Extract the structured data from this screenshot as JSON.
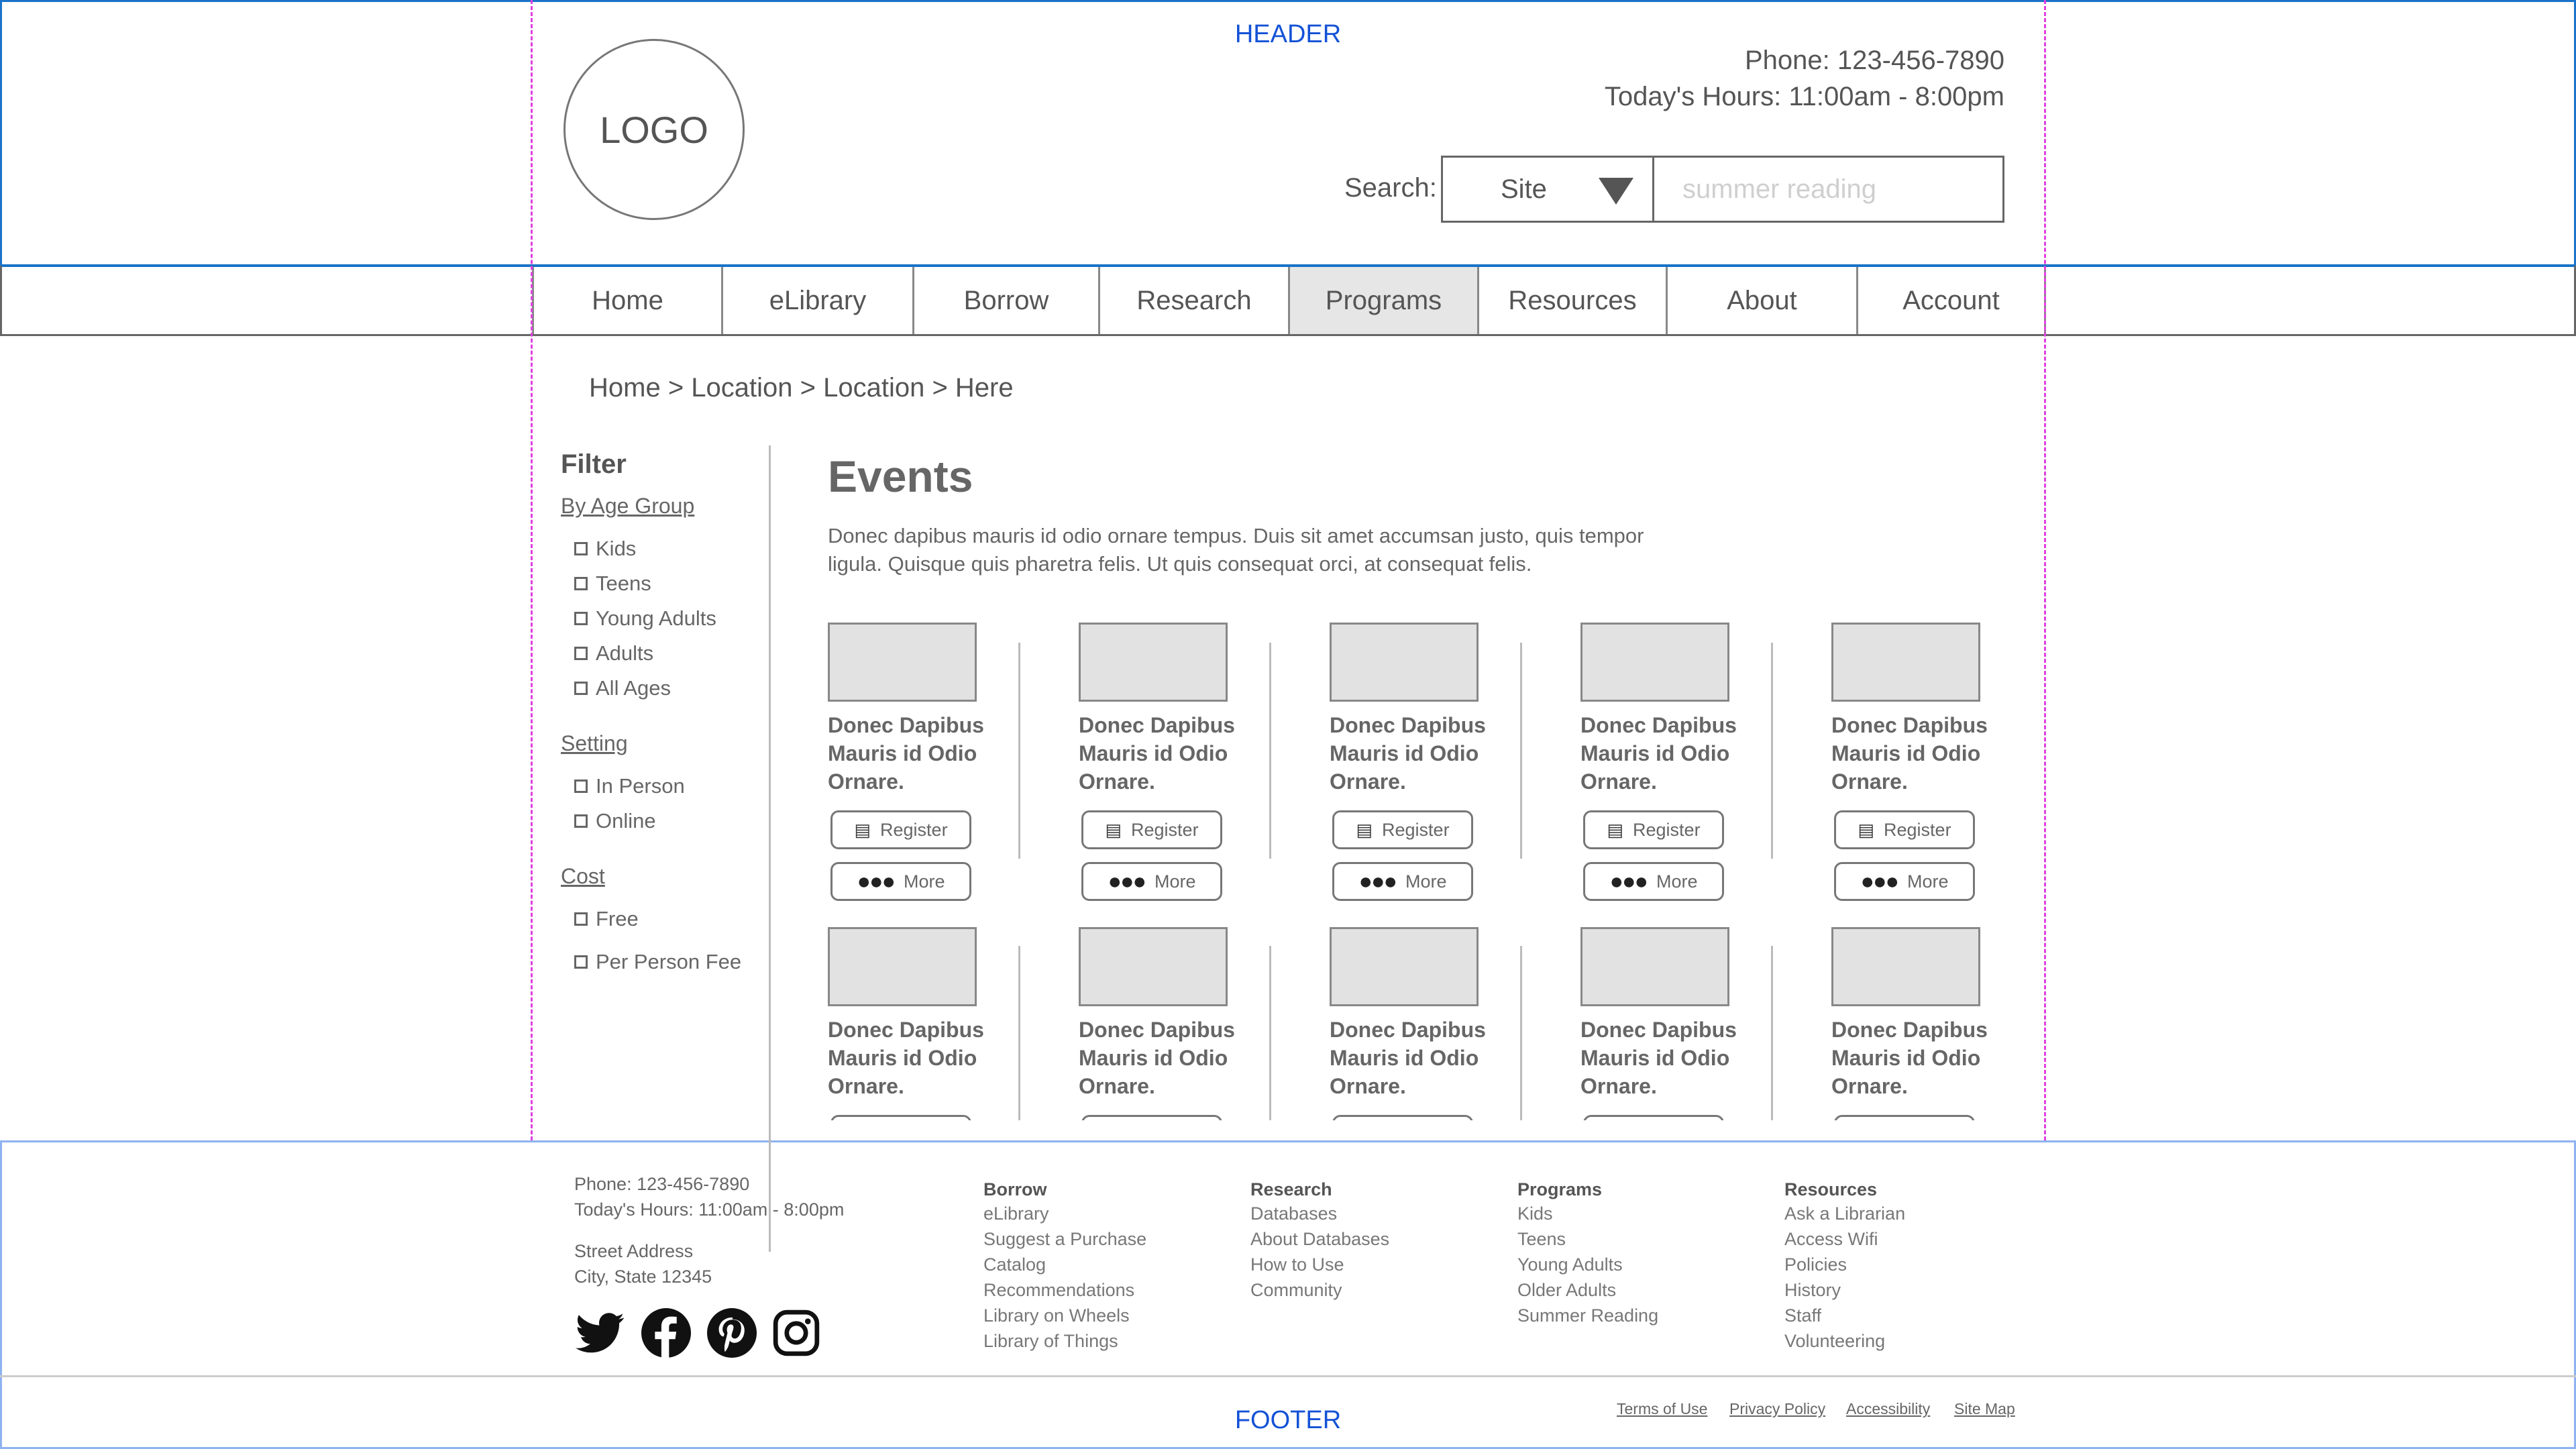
{
  "header": {
    "label": "HEADER",
    "logo": "LOGO",
    "phone": "Phone: 123-456-7890",
    "hours": "Today's Hours:  11:00am - 8:00pm",
    "search_label": "Search:",
    "search_scope": "Site",
    "search_placeholder": "summer reading"
  },
  "nav": {
    "items": [
      {
        "label": "Home"
      },
      {
        "label": "eLibrary"
      },
      {
        "label": "Borrow"
      },
      {
        "label": "Research"
      },
      {
        "label": "Programs",
        "active": true
      },
      {
        "label": "Resources"
      },
      {
        "label": "About"
      },
      {
        "label": "Account"
      }
    ]
  },
  "breadcrumb": "Home > Location > Location > Here",
  "filter": {
    "title": "Filter",
    "groups": [
      {
        "heading": "By Age Group",
        "options": [
          "Kids",
          "Teens",
          "Young Adults",
          "Adults",
          "All Ages"
        ]
      },
      {
        "heading": "Setting",
        "options": [
          "In Person",
          "Online"
        ]
      },
      {
        "heading": "Cost",
        "options": [
          "Free",
          "Per Person Fee"
        ]
      }
    ]
  },
  "events": {
    "title": "Events",
    "description": "Donec dapibus mauris id odio ornare tempus. Duis sit amet accumsan justo, quis tempor ligula. Quisque quis pharetra felis. Ut quis consequat orci, at consequat felis.",
    "register_label": "Register",
    "more_label": "More",
    "cards": [
      {
        "title": "Donec Dapibus Mauris id Odio Ornare."
      },
      {
        "title": "Donec Dapibus Mauris id Odio Ornare."
      },
      {
        "title": "Donec Dapibus Mauris id Odio Ornare."
      },
      {
        "title": "Donec Dapibus Mauris id Odio Ornare."
      },
      {
        "title": "Donec Dapibus Mauris id Odio Ornare."
      },
      {
        "title": "Donec Dapibus Mauris id Odio Ornare."
      },
      {
        "title": "Donec Dapibus Mauris id Odio Ornare."
      },
      {
        "title": "Donec Dapibus Mauris id Odio Ornare."
      },
      {
        "title": "Donec Dapibus Mauris id Odio Ornare."
      },
      {
        "title": "Donec Dapibus Mauris id Odio Ornare."
      }
    ]
  },
  "footer": {
    "label": "FOOTER",
    "phone": "Phone: 123-456-7890",
    "hours": "Today's Hours:  11:00am - 8:00pm",
    "address1": "Street Address",
    "address2": "City, State 12345",
    "social_icons": [
      "twitter-icon",
      "facebook-icon",
      "pinterest-icon",
      "instagram-icon"
    ],
    "columns": [
      {
        "heading": "Borrow",
        "links": [
          "eLibrary",
          "Suggest a Purchase",
          "Catalog",
          "Recommendations",
          "Library on Wheels",
          "Library of Things"
        ]
      },
      {
        "heading": "Research",
        "links": [
          "Databases",
          "About Databases",
          "How to Use",
          "Community"
        ]
      },
      {
        "heading": "Programs",
        "links": [
          "Kids",
          "Teens",
          "Young Adults",
          "Older Adults",
          "Summer Reading"
        ]
      },
      {
        "heading": "Resources",
        "links": [
          "Ask a Librarian",
          "Access Wifi",
          "Policies",
          "History",
          "Staff",
          "Volunteering"
        ]
      }
    ],
    "legal": [
      "Terms of Use",
      "Privacy Policy",
      "Accessibility",
      "Site Map"
    ]
  },
  "colors": {
    "header_border": "#1a73c7",
    "label_blue": "#1452d6",
    "guide": "#e040e0",
    "active_nav": "#e6e6e6"
  }
}
